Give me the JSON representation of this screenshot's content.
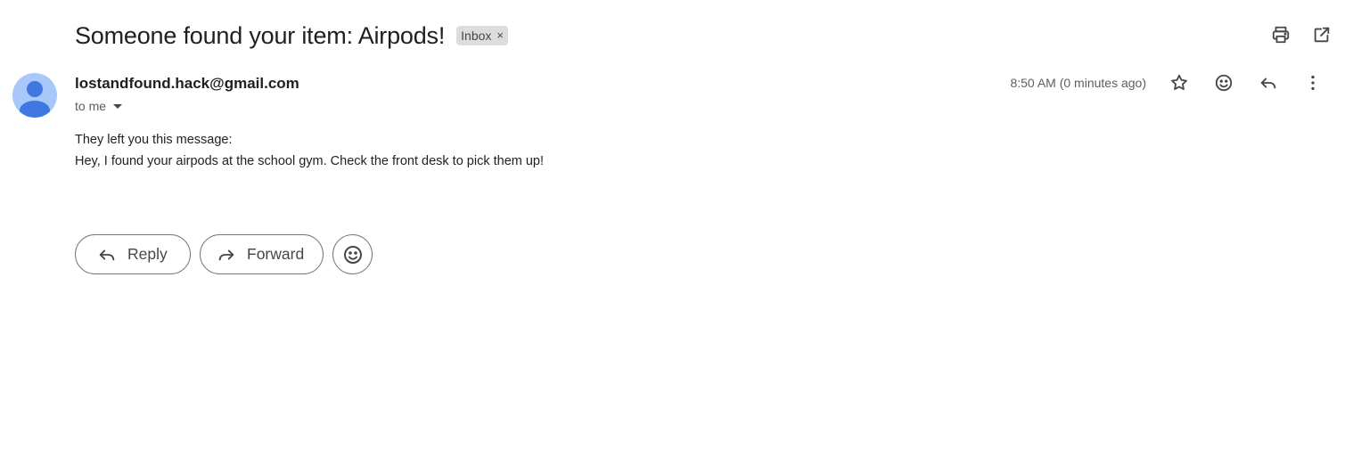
{
  "email": {
    "subject": "Someone found your item: Airpods!",
    "label": "Inbox",
    "label_remove": "×",
    "sender": "lostandfound.hack@gmail.com",
    "recipient": "to me",
    "timestamp": "8:50 AM (0 minutes ago)",
    "body_lines": [
      "They left you this message:",
      "Hey, I found your airpods at the school gym. Check the front desk to pick them up!"
    ]
  },
  "actions": {
    "reply_label": "Reply",
    "forward_label": "Forward"
  },
  "icons": {
    "top": [
      "print-icon",
      "open-in-new-window-icon"
    ],
    "meta": [
      "star-icon",
      "emoji-icon",
      "reply-icon",
      "more-vert-icon"
    ]
  }
}
